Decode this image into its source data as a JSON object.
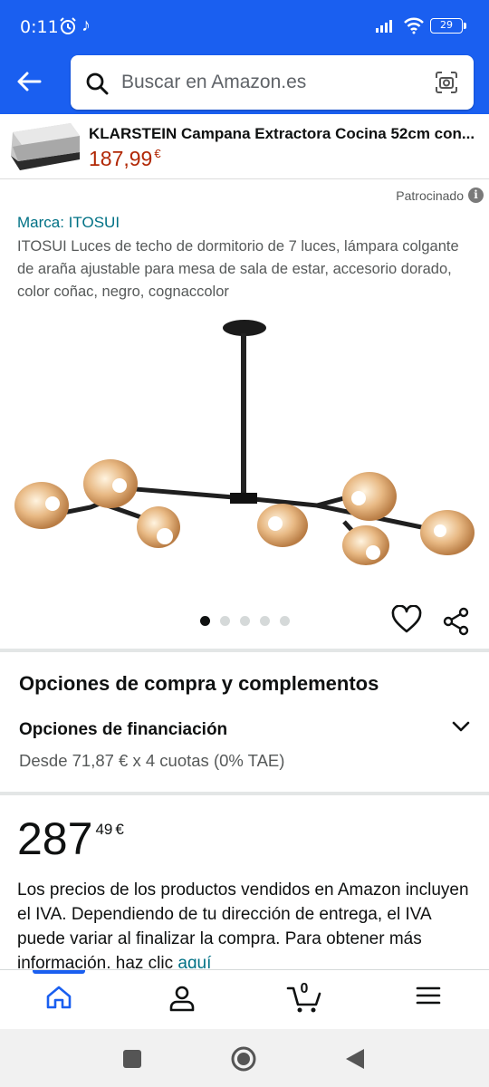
{
  "status_bar": {
    "time": "0:11",
    "battery": "29"
  },
  "search": {
    "placeholder": "Buscar en Amazon.es"
  },
  "ad": {
    "title": "KLARSTEIN Campana Extractora Cocina 52cm con...",
    "price": "187,99",
    "currency": "€"
  },
  "sponsored_label": "Patrocinado",
  "product": {
    "brand": "Marca: ITOSUI",
    "title": "ITOSUI Luces de techo de dormitorio de 7 luces, lámpara colgante de araña ajustable para mesa de sala de estar, accesorio dorado, color coñac, negro, cognaccolor",
    "image_count": 5,
    "active_image": 1
  },
  "purchase_options": {
    "title": "Opciones de compra y complementos",
    "financing_title": "Opciones de financiación",
    "financing_detail": "Desde 71,87 € x 4 cuotas (0% TAE)"
  },
  "price": {
    "whole": "287",
    "fraction": "49",
    "currency": "€"
  },
  "vat": {
    "text": "Los precios de los productos vendidos en Amazon incluyen el IVA. Dependiendo de tu dirección de entrega, el IVA puede variar al finalizar la compra. Para obtener más información, haz clic ",
    "link": "aquí"
  },
  "bottom_nav": {
    "cart_count": "0"
  },
  "colors": {
    "brand_blue": "#1a5ff0",
    "link": "#007185",
    "price_red": "#b12704"
  }
}
